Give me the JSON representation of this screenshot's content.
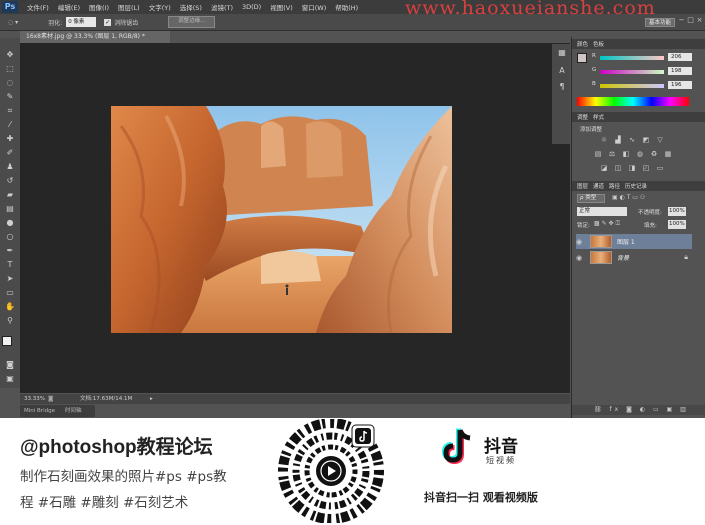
{
  "app": {
    "logo": "Ps",
    "menu": [
      "文件(F)",
      "编辑(E)",
      "图像(I)",
      "图层(L)",
      "文字(Y)",
      "选择(S)",
      "滤镜(T)",
      "3D(D)",
      "视图(V)",
      "窗口(W)",
      "帮助(H)"
    ],
    "watermark": "www.haoxueianshe.com",
    "workspace": "基本功能",
    "window_controls": [
      "−",
      "□",
      "×"
    ]
  },
  "options_bar": {
    "feather_label": "羽化:",
    "feather_value": "0 像素",
    "antialias_label": "消除锯齿",
    "refine_edge": "调整边缘..."
  },
  "tools": [
    {
      "icon": "move-icon",
      "glyph": "✥"
    },
    {
      "icon": "marquee-icon",
      "glyph": "⬚"
    },
    {
      "icon": "lasso-icon",
      "glyph": "◌"
    },
    {
      "icon": "quick-select-icon",
      "glyph": "✎"
    },
    {
      "icon": "crop-icon",
      "glyph": "⌗"
    },
    {
      "icon": "eyedropper-icon",
      "glyph": "⁄"
    },
    {
      "icon": "healing-icon",
      "glyph": "✚"
    },
    {
      "icon": "brush-icon",
      "glyph": "✐"
    },
    {
      "icon": "stamp-icon",
      "glyph": "♟"
    },
    {
      "icon": "history-brush-icon",
      "glyph": "↺"
    },
    {
      "icon": "eraser-icon",
      "glyph": "▰"
    },
    {
      "icon": "gradient-icon",
      "glyph": "▤"
    },
    {
      "icon": "blur-icon",
      "glyph": "●"
    },
    {
      "icon": "dodge-icon",
      "glyph": "○"
    },
    {
      "icon": "pen-icon",
      "glyph": "✒"
    },
    {
      "icon": "type-icon",
      "glyph": "T"
    },
    {
      "icon": "path-select-icon",
      "glyph": "➤"
    },
    {
      "icon": "shape-icon",
      "glyph": "▭"
    },
    {
      "icon": "hand-icon",
      "glyph": "✋"
    },
    {
      "icon": "zoom-icon",
      "glyph": "⚲"
    }
  ],
  "document": {
    "tab_title": "16x8素材.jpg @ 33.3% (图层 1, RGB/8) *",
    "zoom": "33.33%",
    "doc_size": "文档:17.63M/14.1M"
  },
  "bottom_tabs": [
    "Mini Bridge",
    "时间轴"
  ],
  "color_panel": {
    "tabs": [
      "颜色",
      "色板"
    ],
    "channels": [
      {
        "label": "R",
        "value": "206"
      },
      {
        "label": "G",
        "value": "198"
      },
      {
        "label": "B",
        "value": "196"
      }
    ],
    "fg_color": "#cec6c4"
  },
  "adjustments_panel": {
    "tabs": [
      "调整",
      "样式"
    ],
    "title": "添加调整"
  },
  "layers_panel": {
    "tabs": [
      "图层",
      "通道",
      "路径",
      "历史记录"
    ],
    "filter": "ρ 类型",
    "blend_mode": "正常",
    "opacity_label": "不透明度:",
    "opacity_value": "100%",
    "lock_label": "锁定:",
    "fill_label": "填充:",
    "fill_value": "100%",
    "layers": [
      {
        "name": "图层 1",
        "selected": true
      },
      {
        "name": "背景",
        "selected": false
      }
    ]
  },
  "caption": {
    "account": "@photoshop教程论坛",
    "line1": "制作石刻画效果的照片#ps #ps教",
    "line2": "程 #石雕 #雕刻 #石刻艺术",
    "douyin_name": "抖音",
    "douyin_sub": "短视频",
    "cta": "抖音扫一扫 观看视频版"
  }
}
